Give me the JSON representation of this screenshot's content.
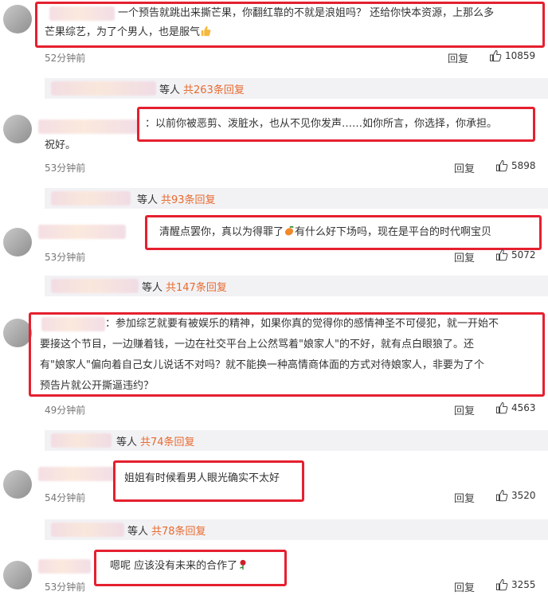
{
  "comments": [
    {
      "text_line1": "一个预告就跳出来撕芒果，你翻红靠的不就是浪姐吗？ 还给你快本资源，上那么多",
      "text_line2": "芒果综艺，为了个男人，也是服气",
      "emoji": "thumbs-up-icon",
      "time": "52分钟前",
      "reply_label": "回复",
      "likes": "10859",
      "replies_people": "等人",
      "replies_count": "共263条回复"
    },
    {
      "text_line1": "：以前你被恶剪、泼脏水，也从不见你发声……如你所言，你选择，你承担。",
      "text_line2": "祝好。",
      "time": "53分钟前",
      "reply_label": "回复",
      "likes": "5898",
      "replies_people": "等人",
      "replies_count": "共93条回复"
    },
    {
      "text_pre": "清醒点罢你，真以为得罪了",
      "emoji": "mango-icon",
      "text_post": "有什么好下场吗，现在是平台的时代啊宝贝",
      "time": "53分钟前",
      "reply_label": "回复",
      "likes": "5072",
      "replies_people": "等人",
      "replies_count": "共147条回复"
    },
    {
      "text_line1": "：参加综艺就要有被娱乐的精神，如果你真的觉得你的感情神圣不可侵犯，就一开始不",
      "text_line2": "要接这个节目，一边赚着钱，一边在社交平台上公然骂着\"娘家人\"的不好，就有点白眼狼了。还",
      "text_line3": "有\"娘家人\"偏向着自己女儿说话不对吗？就不能换一种高情商体面的方式对待娘家人，非要为了个",
      "text_line4": "预告片就公开撕逼违约？",
      "time": "49分钟前",
      "reply_label": "回复",
      "likes": "4563",
      "replies_people": "等人",
      "replies_count": "共74条回复"
    },
    {
      "text_line1": "姐姐有时候看男人眼光确实不太好",
      "time": "54分钟前",
      "reply_label": "回复",
      "likes": "3520",
      "replies_people": "等人",
      "replies_count": "共78条回复"
    },
    {
      "text_line1": "嗯呢 应该没有未来的合作了",
      "emoji": "rose-icon",
      "time": "53分钟前",
      "reply_label": "回复",
      "likes": "3255"
    }
  ],
  "colors": {
    "highlight": "#e5202f",
    "reply_count": "#e86a2e",
    "reply_bar": "#f2f2f5"
  }
}
